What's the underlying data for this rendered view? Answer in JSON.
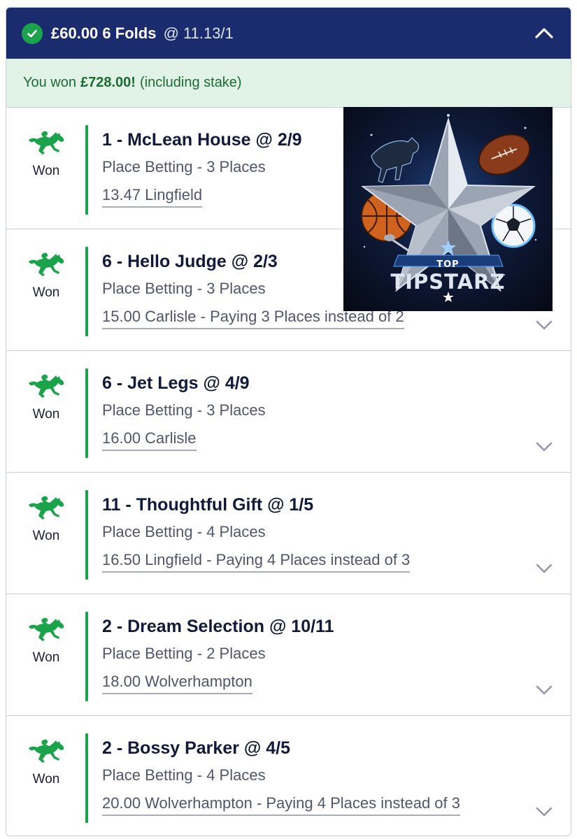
{
  "header": {
    "stake": "£60.00",
    "bet_type": "6 Folds",
    "odds": "@ 11.13/1"
  },
  "banner": {
    "prefix": "You won",
    "amount": "£728.00!",
    "suffix": "(including stake)"
  },
  "legs": [
    {
      "status": "Won",
      "title": "1 - McLean House @ 2/9",
      "market": "Place Betting - 3 Places",
      "event": "13.47 Lingfield"
    },
    {
      "status": "Won",
      "title": "6 - Hello Judge @ 2/3",
      "market": "Place Betting - 3 Places",
      "event": "15.00 Carlisle - Paying 3 Places instead of 2"
    },
    {
      "status": "Won",
      "title": "6 - Jet Legs @ 4/9",
      "market": "Place Betting - 3 Places",
      "event": "16.00 Carlisle"
    },
    {
      "status": "Won",
      "title": "11 - Thoughtful Gift @ 1/5",
      "market": "Place Betting - 4 Places",
      "event": "16.50 Lingfield - Paying 4 Places instead of 3"
    },
    {
      "status": "Won",
      "title": "2 - Dream Selection @ 10/11",
      "market": "Place Betting - 2 Places",
      "event": "18.00 Wolverhampton"
    },
    {
      "status": "Won",
      "title": "2 - Bossy Parker @ 4/5",
      "market": "Place Betting - 4 Places",
      "event": "20.00 Wolverhampton - Paying 4 Places instead of 3"
    }
  ],
  "overlay_logo": {
    "line1": "TOP",
    "line2": "TIPSTARZ"
  },
  "colors": {
    "header_bg": "#1a2c6e",
    "win_green": "#1aa34a",
    "banner_bg": "#e1f3e6"
  },
  "icons": {
    "header": "check-circle-icon",
    "collapse": "chevron-up-icon",
    "leg_status": "horse-racing-icon",
    "leg_expand": "chevron-down-icon"
  }
}
